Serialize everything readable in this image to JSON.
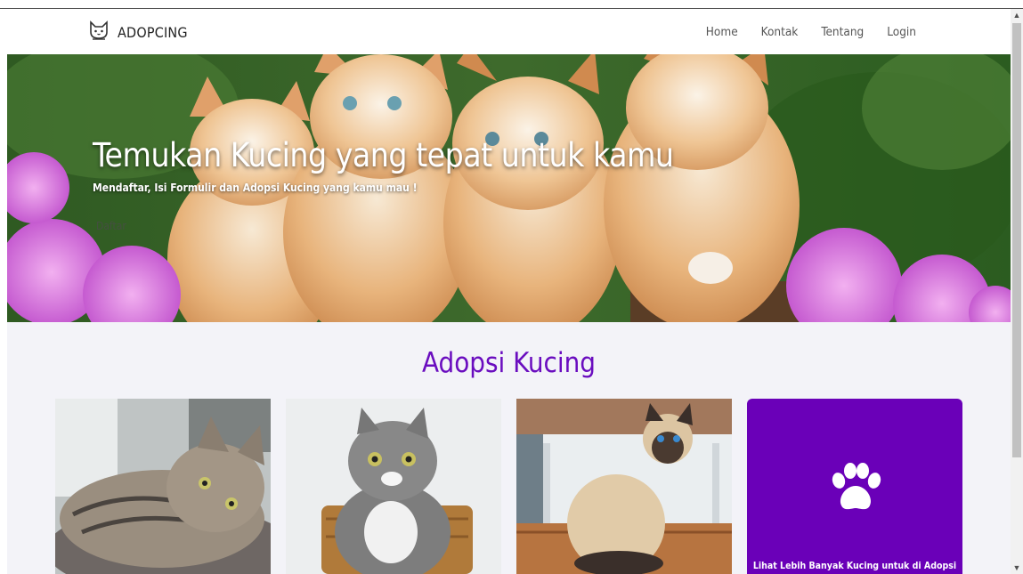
{
  "navbar": {
    "brand": "ADOPCING",
    "links": [
      "Home",
      "Kontak",
      "Tentang",
      "Login"
    ]
  },
  "hero": {
    "title": "Temukan Kucing yang tepat untuk kamu",
    "subtitle": "Mendaftar, Isi Formulir dan Adopsi Kucing yang kamu mau !",
    "button": "Daftar"
  },
  "adopt": {
    "title": "Adopsi Kucing",
    "more_label": "Lihat Lebih Banyak Kucing untuk di Adopsi"
  },
  "colors": {
    "accent": "#6a0dbf",
    "card_purple": "#6a00b8"
  },
  "icons": [
    "cat-logo-icon",
    "paw-icon",
    "scroll-up-arrow-icon",
    "scroll-down-arrow-icon"
  ]
}
